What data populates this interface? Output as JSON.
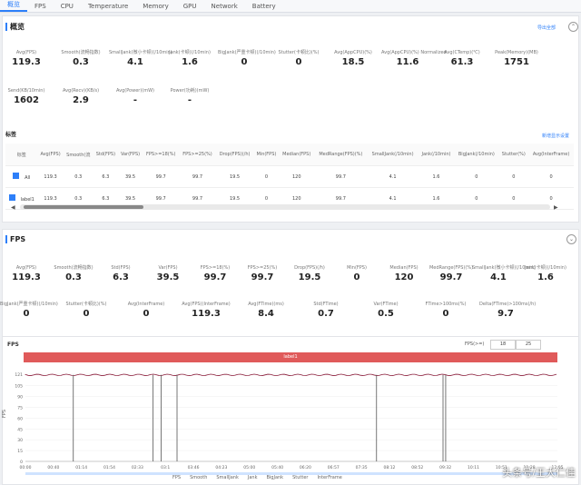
{
  "tabs": [
    "概览",
    "FPS",
    "CPU",
    "Temperature",
    "Memory",
    "GPU",
    "Network",
    "Battery"
  ],
  "overview": {
    "title": "概览",
    "link": "导出全部",
    "row1": [
      {
        "label": "Avg(FPS)",
        "value": "119.3"
      },
      {
        "label": "Smooth(流畅指数)",
        "value": "0.3"
      },
      {
        "label": "SmallJank(微小卡顿)(/10min)",
        "value": "4.1"
      },
      {
        "label": "Jank(卡顿)(/10min)",
        "value": "1.6"
      },
      {
        "label": "BigJank(严重卡顿)(/10min)",
        "value": "0"
      },
      {
        "label": "Stutter(卡顿比)(%)",
        "value": "0"
      },
      {
        "label": "Avg(AppCPU)(%)",
        "value": "18.5"
      },
      {
        "label": "Avg(AppCPU)(%) Normalized",
        "value": "11.6"
      },
      {
        "label": "Avg(CTemp)(℃)",
        "value": "61.3"
      },
      {
        "label": "Peak(Memory)(MB)",
        "value": "1751"
      }
    ],
    "row2": [
      {
        "label": "Send(KB/10min)",
        "value": "1602"
      },
      {
        "label": "Avg(Recv)(KB/s)",
        "value": "2.9"
      },
      {
        "label": "Avg(Power)(mW)",
        "value": "-"
      },
      {
        "label": "Power(功耗)(mW)",
        "value": "-"
      }
    ]
  },
  "labels_section": {
    "title": "标签",
    "link": "新增显示设置",
    "headers": [
      "标签",
      "Avg(FPS)",
      "Smooth(流",
      "Std(FPS)",
      "Var(FPS)",
      "FPS>=18(%)",
      "FPS>=25(%)",
      "Drop(FPS)(/h)",
      "Min(FPS)",
      "Median(FPS)",
      "MedRange(FPS)(%)",
      "SmallJank(/10min)",
      "Jank(/10min)",
      "BigJank(/10min)",
      "Stutter(%)",
      "Avg(InterFrame)"
    ],
    "rows": [
      [
        "All",
        "119.3",
        "0.3",
        "6.3",
        "39.5",
        "99.7",
        "99.7",
        "19.5",
        "0",
        "120",
        "99.7",
        "4.1",
        "1.6",
        "0",
        "0",
        "0"
      ],
      [
        "label1",
        "119.3",
        "0.3",
        "6.3",
        "39.5",
        "99.7",
        "99.7",
        "19.5",
        "0",
        "120",
        "99.7",
        "4.1",
        "1.6",
        "0",
        "0",
        "0"
      ]
    ]
  },
  "fps_section": {
    "title": "FPS",
    "row1": [
      {
        "label": "Avg(FPS)",
        "value": "119.3"
      },
      {
        "label": "Smooth(流畅指数)",
        "value": "0.3"
      },
      {
        "label": "Std(FPS)",
        "value": "6.3"
      },
      {
        "label": "Var(FPS)",
        "value": "39.5"
      },
      {
        "label": "FPS>=18(%)",
        "value": "99.7"
      },
      {
        "label": "FPS>=25(%)",
        "value": "99.7"
      },
      {
        "label": "Drop(FPS)(/h)",
        "value": "19.5"
      },
      {
        "label": "Min(FPS)",
        "value": "0"
      },
      {
        "label": "Median(FPS)",
        "value": "120"
      },
      {
        "label": "MedRange(FPS)(%)",
        "value": "99.7"
      },
      {
        "label": "SmallJank(微小卡顿)(/10min)",
        "value": "4.1"
      },
      {
        "label": "Jank(卡顿)(/10min)",
        "value": "1.6"
      }
    ],
    "row2": [
      {
        "label": "BigJank(严重卡顿)(/10min)",
        "value": "0"
      },
      {
        "label": "Stutter(卡顿比)(%)",
        "value": "0"
      },
      {
        "label": "Avg(InterFrame)",
        "value": "0"
      },
      {
        "label": "Avg(FPS)(InterFrame)",
        "value": "119.3"
      },
      {
        "label": "Avg(FTime)(ms)",
        "value": "8.4"
      },
      {
        "label": "Std(FTime)",
        "value": "0.7"
      },
      {
        "label": "Var(FTime)",
        "value": "0.5"
      },
      {
        "label": "FTime>100ms(%)",
        "value": "0"
      },
      {
        "label": "Delta(FTime)>100ms(/h)",
        "value": "9.7"
      }
    ]
  },
  "chart_panel": {
    "title": "FPS",
    "controls_label": "FPS(>=)",
    "btn1": "18",
    "btn2": "25",
    "bar_label": "label1"
  },
  "chart_data": {
    "type": "line",
    "ylabel": "FPS",
    "yticks": [
      "0",
      "15",
      "30",
      "45",
      "60",
      "75",
      "90",
      "105",
      "121"
    ],
    "xticks": [
      "00:00",
      "00:40",
      "01:14",
      "01:54",
      "02:33",
      "03:1",
      "03:46",
      "04:23",
      "05:00",
      "05:40",
      "06:20",
      "06:57",
      "07:35",
      "08:12",
      "08:52",
      "09:32",
      "10:11",
      "10:51",
      "11:28",
      "12:05"
    ],
    "ylim": [
      0,
      121
    ],
    "baseline": 120,
    "drops": [
      {
        "t": 0.09,
        "v": 60
      },
      {
        "t": 0.24,
        "v": 60
      },
      {
        "t": 0.255,
        "v": 60
      },
      {
        "t": 0.285,
        "v": 60
      },
      {
        "t": 0.66,
        "v": 60
      },
      {
        "t": 0.785,
        "v": 100
      },
      {
        "t": 0.79,
        "v": 100
      }
    ],
    "legend": [
      "FPS",
      "Smooth",
      "SmallJank",
      "Jank",
      "BigJank",
      "Stutter",
      "InterFrame"
    ]
  },
  "watermark": "头条号/王大仁佳"
}
